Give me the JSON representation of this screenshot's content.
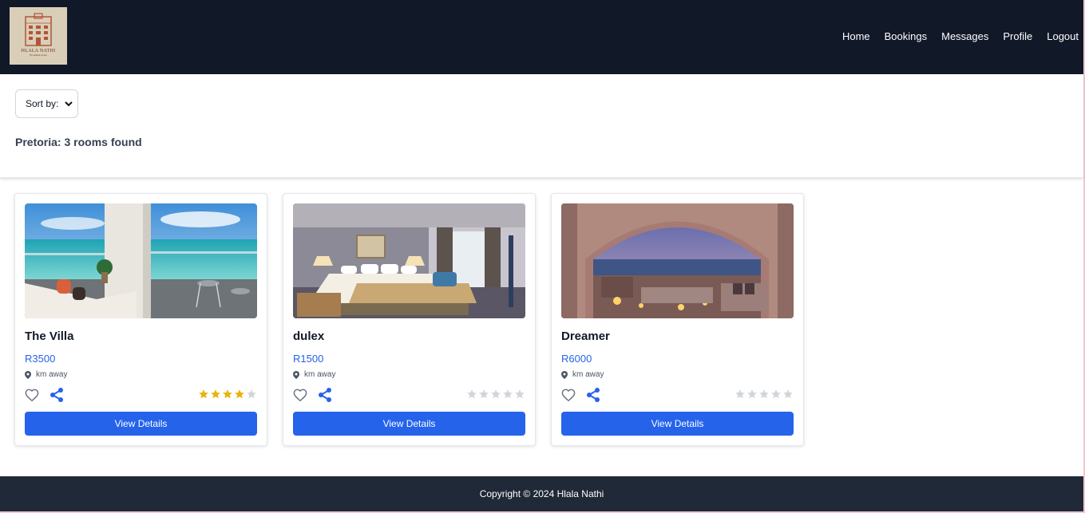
{
  "brand": {
    "logo_title": "HLALA NATHI",
    "logo_subtitle": "By Adhera Group"
  },
  "nav": {
    "items": [
      "Home",
      "Bookings",
      "Messages",
      "Profile",
      "Logout"
    ]
  },
  "filters": {
    "sort_label": "Sort by:"
  },
  "results": {
    "summary": "Pretoria: 3 rooms found"
  },
  "rooms": [
    {
      "title": "The Villa",
      "price": "R3500",
      "distance": "km away",
      "rating": 4,
      "max_rating": 5,
      "button": "View Details"
    },
    {
      "title": "dulex",
      "price": "R1500",
      "distance": "km away",
      "rating": 0,
      "max_rating": 5,
      "button": "View Details"
    },
    {
      "title": "Dreamer",
      "price": "R6000",
      "distance": "km away",
      "rating": 0,
      "max_rating": 5,
      "button": "View Details"
    }
  ],
  "footer": {
    "copyright": "Copyright © 2024 Hlala Nathi"
  },
  "colors": {
    "header_bg": "#111827",
    "footer_bg": "#1f2937",
    "accent": "#2563eb",
    "star_filled": "#eab308",
    "star_empty": "#d1d5db"
  },
  "icons": {
    "logo": "hotel-building-logo",
    "sort": "chevron-down-icon",
    "location": "map-pin-icon",
    "favorite": "heart-icon",
    "share": "share-icon",
    "rating": "star-icon"
  }
}
